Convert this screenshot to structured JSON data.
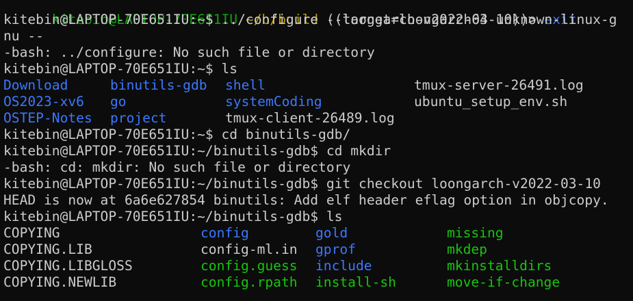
{
  "window": {
    "background": "#0c0c0c",
    "colors": {
      "default": "#cccccc",
      "prompt_green": "#13a10e",
      "directory_blue": "#3b78ff",
      "executable_green": "#16c60c",
      "path_yellow": "#c19c00"
    }
  },
  "lines": [
    {
      "segments": [
        {
          "text": "kitebin@LAPTOP-70E651IU",
          "color": "green"
        },
        {
          "text": " ",
          "color": "default"
        },
        {
          "text": "~/b/build",
          "color": "yellow"
        },
        {
          "text": " ((loongarch-v2022-03-10))> ",
          "color": "default"
        },
        {
          "text": "exit",
          "color": "blue"
        }
      ]
    },
    {
      "segments": [
        {
          "text": "kitebin@LAPTOP-70E651IU:~$ ../configure --target=loongarch64-unknown-linux-g",
          "color": "default"
        }
      ]
    },
    {
      "segments": [
        {
          "text": "nu --",
          "color": "default"
        }
      ]
    },
    {
      "segments": [
        {
          "text": "-bash: ../configure: No such file or directory",
          "color": "default"
        }
      ]
    },
    {
      "segments": [
        {
          "text": "kitebin@LAPTOP-70E651IU:~$ ls",
          "color": "default"
        }
      ]
    }
  ],
  "ls_home": [
    [
      {
        "text": "Download",
        "color": "blue"
      },
      {
        "text": "binutils-gdb",
        "color": "blue"
      },
      {
        "text": "shell",
        "color": "blue"
      },
      {
        "text": "tmux-server-26491.log",
        "color": "default"
      }
    ],
    [
      {
        "text": "OS2023-xv6",
        "color": "blue"
      },
      {
        "text": "go",
        "color": "blue"
      },
      {
        "text": "systemCoding",
        "color": "blue"
      },
      {
        "text": "ubuntu_setup_env.sh",
        "color": "default"
      }
    ],
    [
      {
        "text": "OSTEP-Notes",
        "color": "blue"
      },
      {
        "text": "project",
        "color": "blue"
      },
      {
        "text": "tmux-client-26489.log",
        "color": "default"
      },
      {
        "text": "",
        "color": "default"
      }
    ]
  ],
  "lines2": [
    "kitebin@LAPTOP-70E651IU:~$ cd binutils-gdb/",
    "kitebin@LAPTOP-70E651IU:~/binutils-gdb$ cd mkdir",
    "-bash: cd: mkdir: No such file or directory",
    "kitebin@LAPTOP-70E651IU:~/binutils-gdb$ git checkout loongarch-v2022-03-10",
    "HEAD is now at 6a6e627854 binutils: Add elf header eflag option in objcopy.",
    "kitebin@LAPTOP-70E651IU:~/binutils-gdb$ ls"
  ],
  "ls_repo": [
    [
      {
        "text": "COPYING",
        "color": "default"
      },
      {
        "text": "config",
        "color": "blue"
      },
      {
        "text": "gold",
        "color": "blue"
      },
      {
        "text": "missing",
        "color": "bgreen"
      }
    ],
    [
      {
        "text": "COPYING.LIB",
        "color": "default"
      },
      {
        "text": "config-ml.in",
        "color": "default"
      },
      {
        "text": "gprof",
        "color": "blue"
      },
      {
        "text": "mkdep",
        "color": "bgreen"
      }
    ],
    [
      {
        "text": "COPYING.LIBGLOSS",
        "color": "default"
      },
      {
        "text": "config.guess",
        "color": "bgreen"
      },
      {
        "text": "include",
        "color": "blue"
      },
      {
        "text": "mkinstalldirs",
        "color": "bgreen"
      }
    ],
    [
      {
        "text": "COPYING.NEWLIB",
        "color": "default"
      },
      {
        "text": "config.rpath",
        "color": "bgreen"
      },
      {
        "text": "install-sh",
        "color": "bgreen"
      },
      {
        "text": "move-if-change",
        "color": "bgreen"
      }
    ]
  ]
}
